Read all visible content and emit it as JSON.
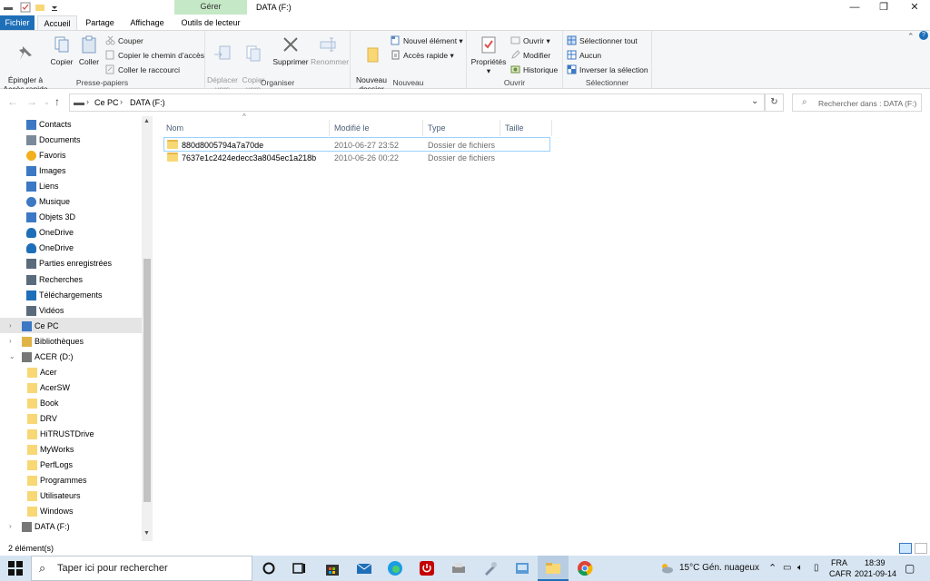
{
  "window": {
    "title": "DATA (F:)",
    "contextual_tab": "Gérer",
    "controls": {
      "minimize": "—",
      "restore": "❐",
      "close": "✕"
    }
  },
  "tabs": [
    "Fichier",
    "Accueil",
    "Partage",
    "Affichage",
    "Outils de lecteur"
  ],
  "ribbon": {
    "clipboard": {
      "label": "Presse-papiers",
      "pin": "Épingler à\nAccès rapide",
      "copy": "Copier",
      "paste": "Coller",
      "cut": "Couper",
      "copy_path": "Copier le chemin d’accès",
      "paste_shortcut": "Coller le raccourci"
    },
    "organize": {
      "label": "Organiser",
      "move": "Déplacer\nvers",
      "copy_to": "Copier\nvers",
      "delete": "Supprimer",
      "rename": "Renommer"
    },
    "new": {
      "label": "Nouveau",
      "new_folder": "Nouveau\ndossier",
      "new_item": "Nouvel élément",
      "easy_access": "Accès rapide"
    },
    "open": {
      "label": "Ouvrir",
      "properties": "Propriétés",
      "open": "Ouvrir",
      "edit": "Modifier",
      "history": "Historique"
    },
    "select": {
      "label": "Sélectionner",
      "all": "Sélectionner tout",
      "none": "Aucun",
      "invert": "Inverser la sélection"
    }
  },
  "address": {
    "crumbs": [
      "Ce PC",
      "DATA (F:)"
    ],
    "search_placeholder": "Rechercher dans : DATA (F:)"
  },
  "nav": {
    "items": [
      {
        "label": "Contacts",
        "icon": "contacts-icon"
      },
      {
        "label": "Documents",
        "icon": "documents-icon"
      },
      {
        "label": "Favoris",
        "icon": "star-icon"
      },
      {
        "label": "Images",
        "icon": "images-icon"
      },
      {
        "label": "Liens",
        "icon": "link-icon"
      },
      {
        "label": "Musique",
        "icon": "music-icon"
      },
      {
        "label": "Objets 3D",
        "icon": "cube-icon"
      },
      {
        "label": "OneDrive",
        "icon": "cloud-icon"
      },
      {
        "label": "OneDrive",
        "icon": "cloud-icon"
      },
      {
        "label": "Parties enregistrées",
        "icon": "saved-games-icon"
      },
      {
        "label": "Recherches",
        "icon": "search-icon"
      },
      {
        "label": "Téléchargements",
        "icon": "download-icon"
      },
      {
        "label": "Vidéos",
        "icon": "video-icon"
      },
      {
        "label": "Ce PC",
        "icon": "pc-icon"
      },
      {
        "label": "Bibliothèques",
        "icon": "library-icon"
      },
      {
        "label": "ACER (D:)",
        "icon": "drive-icon"
      },
      {
        "label": "Acer",
        "icon": "folder-icon"
      },
      {
        "label": "AcerSW",
        "icon": "folder-icon"
      },
      {
        "label": "Book",
        "icon": "folder-icon"
      },
      {
        "label": "DRV",
        "icon": "folder-icon"
      },
      {
        "label": "HiTRUSTDrive",
        "icon": "folder-icon"
      },
      {
        "label": "MyWorks",
        "icon": "folder-icon"
      },
      {
        "label": "PerfLogs",
        "icon": "folder-icon"
      },
      {
        "label": "Programmes",
        "icon": "folder-icon"
      },
      {
        "label": "Utilisateurs",
        "icon": "folder-icon"
      },
      {
        "label": "Windows",
        "icon": "folder-icon"
      },
      {
        "label": "DATA (F:)",
        "icon": "drive-icon"
      }
    ]
  },
  "columns": [
    "Nom",
    "Modifié le",
    "Type",
    "Taille"
  ],
  "files": [
    {
      "name": "880d8005794a7a70de",
      "modified": "2010-06-27 23:52",
      "type": "Dossier de fichiers",
      "size": ""
    },
    {
      "name": "7637e1c2424edecc3a8045ec1a218b",
      "modified": "2010-06-26 00:22",
      "type": "Dossier de fichiers",
      "size": ""
    }
  ],
  "status": {
    "count": "2 élément(s)"
  },
  "taskbar": {
    "search_placeholder": "Taper ici pour rechercher",
    "weather": "15°C  Gén. nuageux",
    "lang": "FRA",
    "layout": "CAFR",
    "time": "18:39",
    "date": "2021-09-14"
  },
  "colors": {
    "accent": "#1e6fb8",
    "folder": "#f8d775",
    "selected": "#cce8ff",
    "gerer": "#c5e8c6"
  }
}
